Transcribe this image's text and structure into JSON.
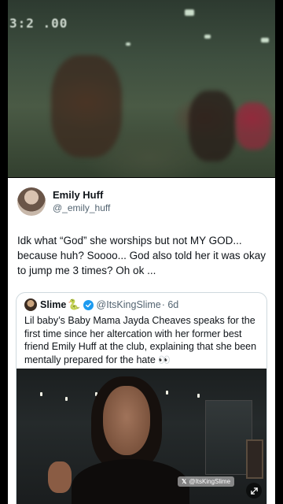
{
  "video": {
    "timestamp": "3:2 .00"
  },
  "tweet": {
    "author_name": "Emily Huff",
    "author_handle": "@_emily_huff",
    "text": "Idk what “God” she worships but not MY GOD... because huh? Soooo... God also told her it was okay to jump me 3 times? Oh ok ..."
  },
  "quote": {
    "author_name": "Slime",
    "author_emoji": "🐍",
    "handle": "@ItsKingSlime",
    "time": "· 6d",
    "text": "Lil baby’s Baby Mama Jayda Cheaves speaks for the first time since her altercation with her former best friend Emily Huff at the club, explaining that she been mentally prepared for the hate 👀",
    "video_watermark": "@ItsKingSlime"
  },
  "colors": {
    "verified": "#1d9bf0",
    "text_primary": "#0f1419",
    "text_secondary": "#536471"
  },
  "icons": [
    "verified-badge-icon",
    "x-logo-icon",
    "expand-icon"
  ]
}
